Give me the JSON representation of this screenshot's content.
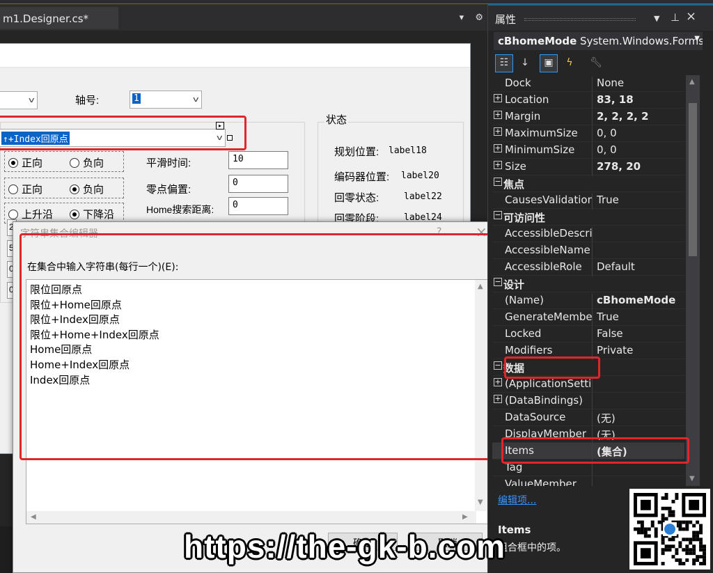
{
  "document_tab": {
    "label": "m1.Designer.cs*"
  },
  "tab_tools": {
    "dropdown": "▾",
    "settings": "⚙"
  },
  "form": {
    "axis_label": "轴号:",
    "axis_value": "1",
    "combo_selected": "↑+Index回原点",
    "status_label": "状态",
    "radio_rows": [
      [
        "正向",
        "负向"
      ],
      [
        "正向",
        "负向"
      ],
      [
        "上升沿",
        "下降沿"
      ]
    ],
    "fields": [
      {
        "label": "平滑时间:",
        "value": "10"
      },
      {
        "label": "零点偏置:",
        "value": "0"
      },
      {
        "label": "Home搜索距离:",
        "value": "0"
      }
    ],
    "status_items": [
      {
        "label": "规划位置:",
        "value": "label18"
      },
      {
        "label": "编码器位置:",
        "value": "label20"
      },
      {
        "label": "回零状态:",
        "value": "label22"
      },
      {
        "label": "回零阶段:",
        "value": "label24"
      }
    ],
    "left_stubs": [
      "2",
      "5",
      "0",
      "0"
    ]
  },
  "dialog": {
    "title": "字符串集合编辑器",
    "help": "?",
    "close": "×",
    "prompt": "在集合中输入字符串(每行一个)(E):",
    "lines": [
      "限位回原点",
      "限位+Home回原点",
      "限位+Index回原点",
      "限位+Home+Index回原点",
      "Home回原点",
      "Home+Index回原点",
      "Index回原点"
    ],
    "buttons": [
      "确定",
      "取消"
    ]
  },
  "properties": {
    "title": "属性",
    "object_name": "cBhomeMode",
    "object_type": "System.Windows.Forms.ComboBox",
    "toolbar_icons": [
      "categorized-icon",
      "alphabetical-icon",
      "properties-icon",
      "events-icon",
      "property-pages-icon"
    ],
    "rows": [
      {
        "type": "prop",
        "name": "Dock",
        "value": "None"
      },
      {
        "type": "prop",
        "expand": "+",
        "name": "Location",
        "value": "83, 18",
        "bold": true
      },
      {
        "type": "prop",
        "expand": "+",
        "name": "Margin",
        "value": "2, 2, 2, 2",
        "bold": true
      },
      {
        "type": "prop",
        "expand": "+",
        "name": "MaximumSize",
        "value": "0, 0"
      },
      {
        "type": "prop",
        "expand": "+",
        "name": "MinimumSize",
        "value": "0, 0"
      },
      {
        "type": "prop",
        "expand": "+",
        "name": "Size",
        "value": "278, 20",
        "bold": true
      },
      {
        "type": "cat",
        "expand": "−",
        "name": "焦点"
      },
      {
        "type": "prop",
        "name": "CausesValidation",
        "value": "True"
      },
      {
        "type": "cat",
        "expand": "−",
        "name": "可访问性"
      },
      {
        "type": "prop",
        "name": "AccessibleDescription",
        "value": ""
      },
      {
        "type": "prop",
        "name": "AccessibleName",
        "value": ""
      },
      {
        "type": "prop",
        "name": "AccessibleRole",
        "value": "Default"
      },
      {
        "type": "cat",
        "expand": "−",
        "name": "设计"
      },
      {
        "type": "prop",
        "name": "(Name)",
        "value": "cBhomeMode",
        "bold": true
      },
      {
        "type": "prop",
        "name": "GenerateMember",
        "value": "True"
      },
      {
        "type": "prop",
        "name": "Locked",
        "value": "False"
      },
      {
        "type": "prop",
        "name": "Modifiers",
        "value": "Private"
      },
      {
        "type": "cat",
        "expand": "−",
        "name": "数据"
      },
      {
        "type": "prop",
        "expand": "+",
        "name": "(ApplicationSettings)",
        "value": ""
      },
      {
        "type": "prop",
        "expand": "+",
        "name": "(DataBindings)",
        "value": ""
      },
      {
        "type": "prop",
        "name": "DataSource",
        "value": "(无)"
      },
      {
        "type": "prop",
        "name": "DisplayMember",
        "value": "(无)"
      },
      {
        "type": "prop",
        "name": "Items",
        "value": "(集合)",
        "bold": true,
        "selected": true
      },
      {
        "type": "prop",
        "name": "Tag",
        "value": ""
      },
      {
        "type": "prop",
        "name": "ValueMember",
        "value": ""
      }
    ],
    "commands_link": "编辑项...",
    "description_title": "Items",
    "description_text": "组合框中的项。"
  },
  "watermark": "https://the-gk-b.com",
  "accent": "#e0262b"
}
